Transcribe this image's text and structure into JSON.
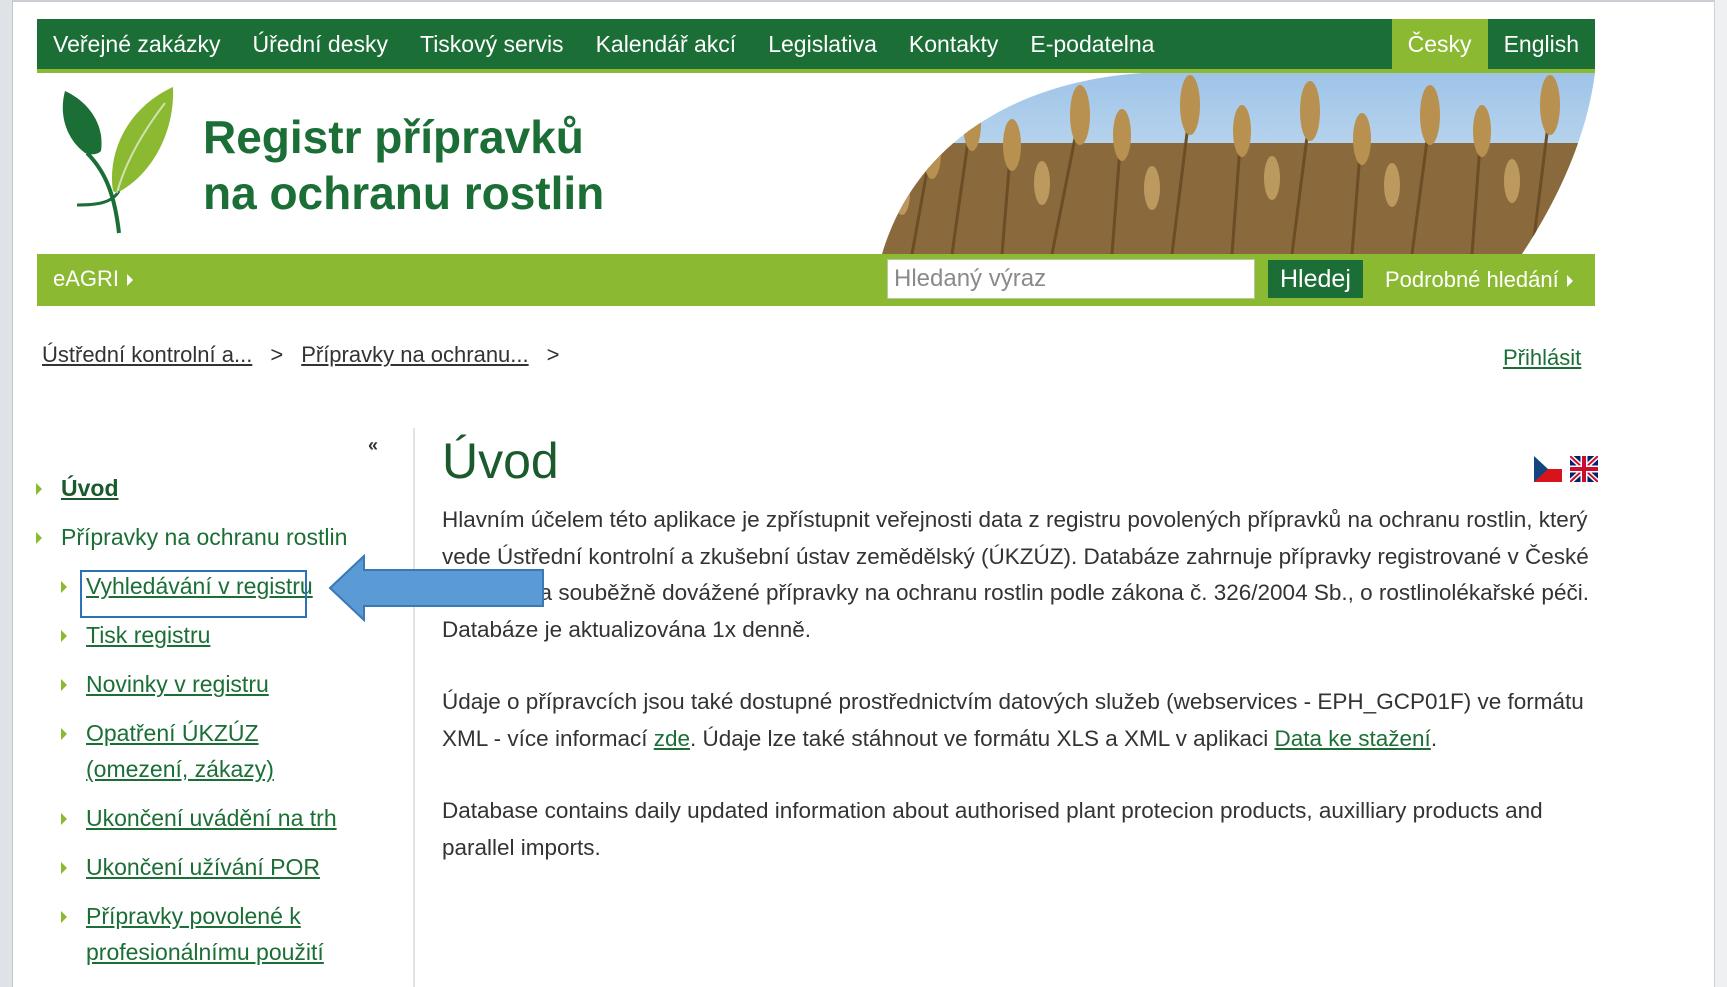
{
  "top_nav": {
    "items": [
      "Veřejné zakázky",
      "Úřední desky",
      "Tiskový servis",
      "Kalendář akcí",
      "Legislativa",
      "Kontakty",
      "E-podatelna"
    ],
    "lang_active": "Česky",
    "lang_other": "English"
  },
  "banner": {
    "title_line1": "Registr přípravků",
    "title_line2": "na ochranu rostlin"
  },
  "search": {
    "eagri_label": "eAGRI",
    "placeholder": "Hledaný výraz",
    "button_label": "Hledej",
    "advanced_label": "Podrobné hledání"
  },
  "breadcrumb": {
    "items": [
      "Ústřední kontrolní a...",
      "Přípravky na ochranu..."
    ],
    "separator": ">",
    "login_label": "Přihlásit"
  },
  "sidebar": {
    "collapse_icon": "«",
    "items": [
      {
        "label": "Úvod"
      },
      {
        "label": "Přípravky na ochranu rostlin"
      },
      {
        "label": "Vyhledávání v registru"
      },
      {
        "label": "Tisk registru"
      },
      {
        "label": "Novinky v registru"
      },
      {
        "label": "Opatření ÚKZÚZ (omezení, zákazy)"
      },
      {
        "label": "Ukončení uvádění na trh"
      },
      {
        "label": "Ukončení užívání POR"
      },
      {
        "label": "Přípravky povolené k profesionálnímu použití"
      }
    ]
  },
  "main": {
    "title": "Úvod",
    "para1": "Hlavním účelem této aplikace je zpřístupnit veřejnosti data z registru povolených přípravků na ochranu rostlin, který vede Ústřední kontrolní a zkušební ústav zemědělský (ÚKZÚZ). Databáze zahrnuje přípravky registrované v České republice a souběžně dovážené přípravky na ochranu rostlin podle zákona č. 326/2004 Sb., o rostlinolékařské péči. Databáze je aktualizována 1x denně.",
    "para2_a": "Údaje o přípravcích jsou také dostupné prostřednictvím datových služeb (webservices - EPH_GCP01F) ve formátu XML - více informací ",
    "para2_link1": "zde",
    "para2_b": ". Údaje lze také stáhnout ve formátu XLS a XML v aplikaci ",
    "para2_link2": "Data ke stažení",
    "para2_c": ".",
    "para3": "Database contains daily updated information about authorised plant protecion products, auxilliary products and parallel imports."
  },
  "colors": {
    "dark_green": "#1b6e35",
    "light_green": "#8bb932",
    "highlight_blue": "#2b73b7",
    "arrow_blue": "#5b9bd5"
  }
}
